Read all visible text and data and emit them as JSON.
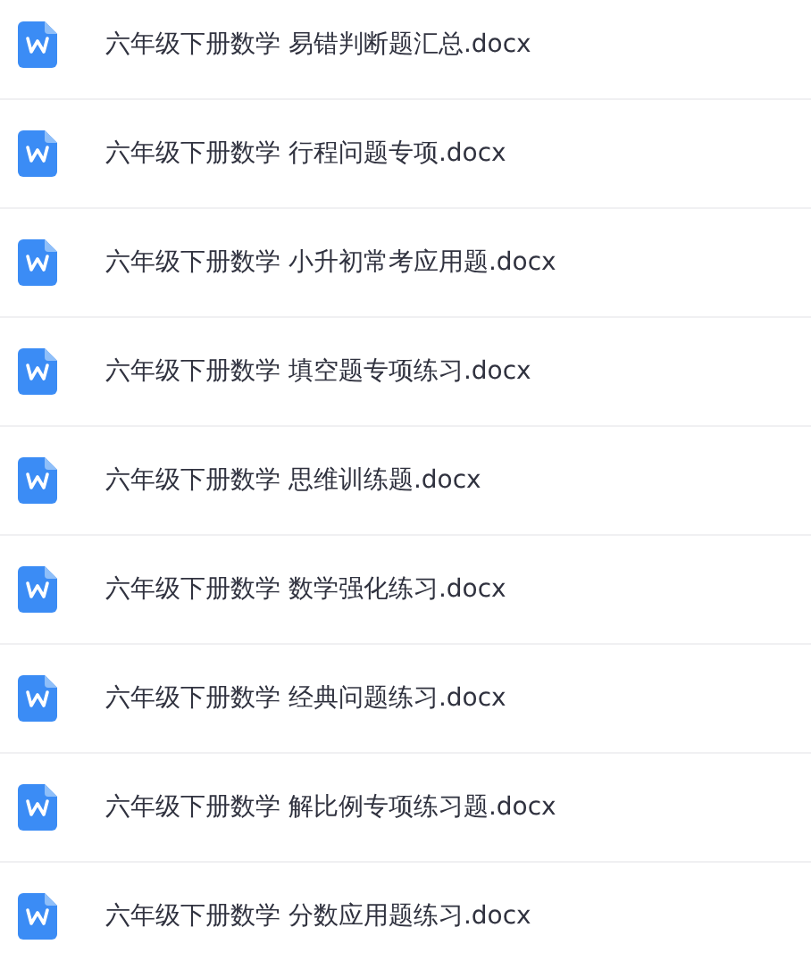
{
  "files": [
    {
      "name": "六年级下册数学 易错判断题汇总.docx"
    },
    {
      "name": "六年级下册数学 行程问题专项.docx"
    },
    {
      "name": "六年级下册数学 小升初常考应用题.docx"
    },
    {
      "name": "六年级下册数学 填空题专项练习.docx"
    },
    {
      "name": "六年级下册数学 思维训练题.docx"
    },
    {
      "name": "六年级下册数学 数学强化练习.docx"
    },
    {
      "name": "六年级下册数学 经典问题练习.docx"
    },
    {
      "name": "六年级下册数学 解比例专项练习题.docx"
    },
    {
      "name": "六年级下册数学 分数应用题练习.docx"
    }
  ]
}
